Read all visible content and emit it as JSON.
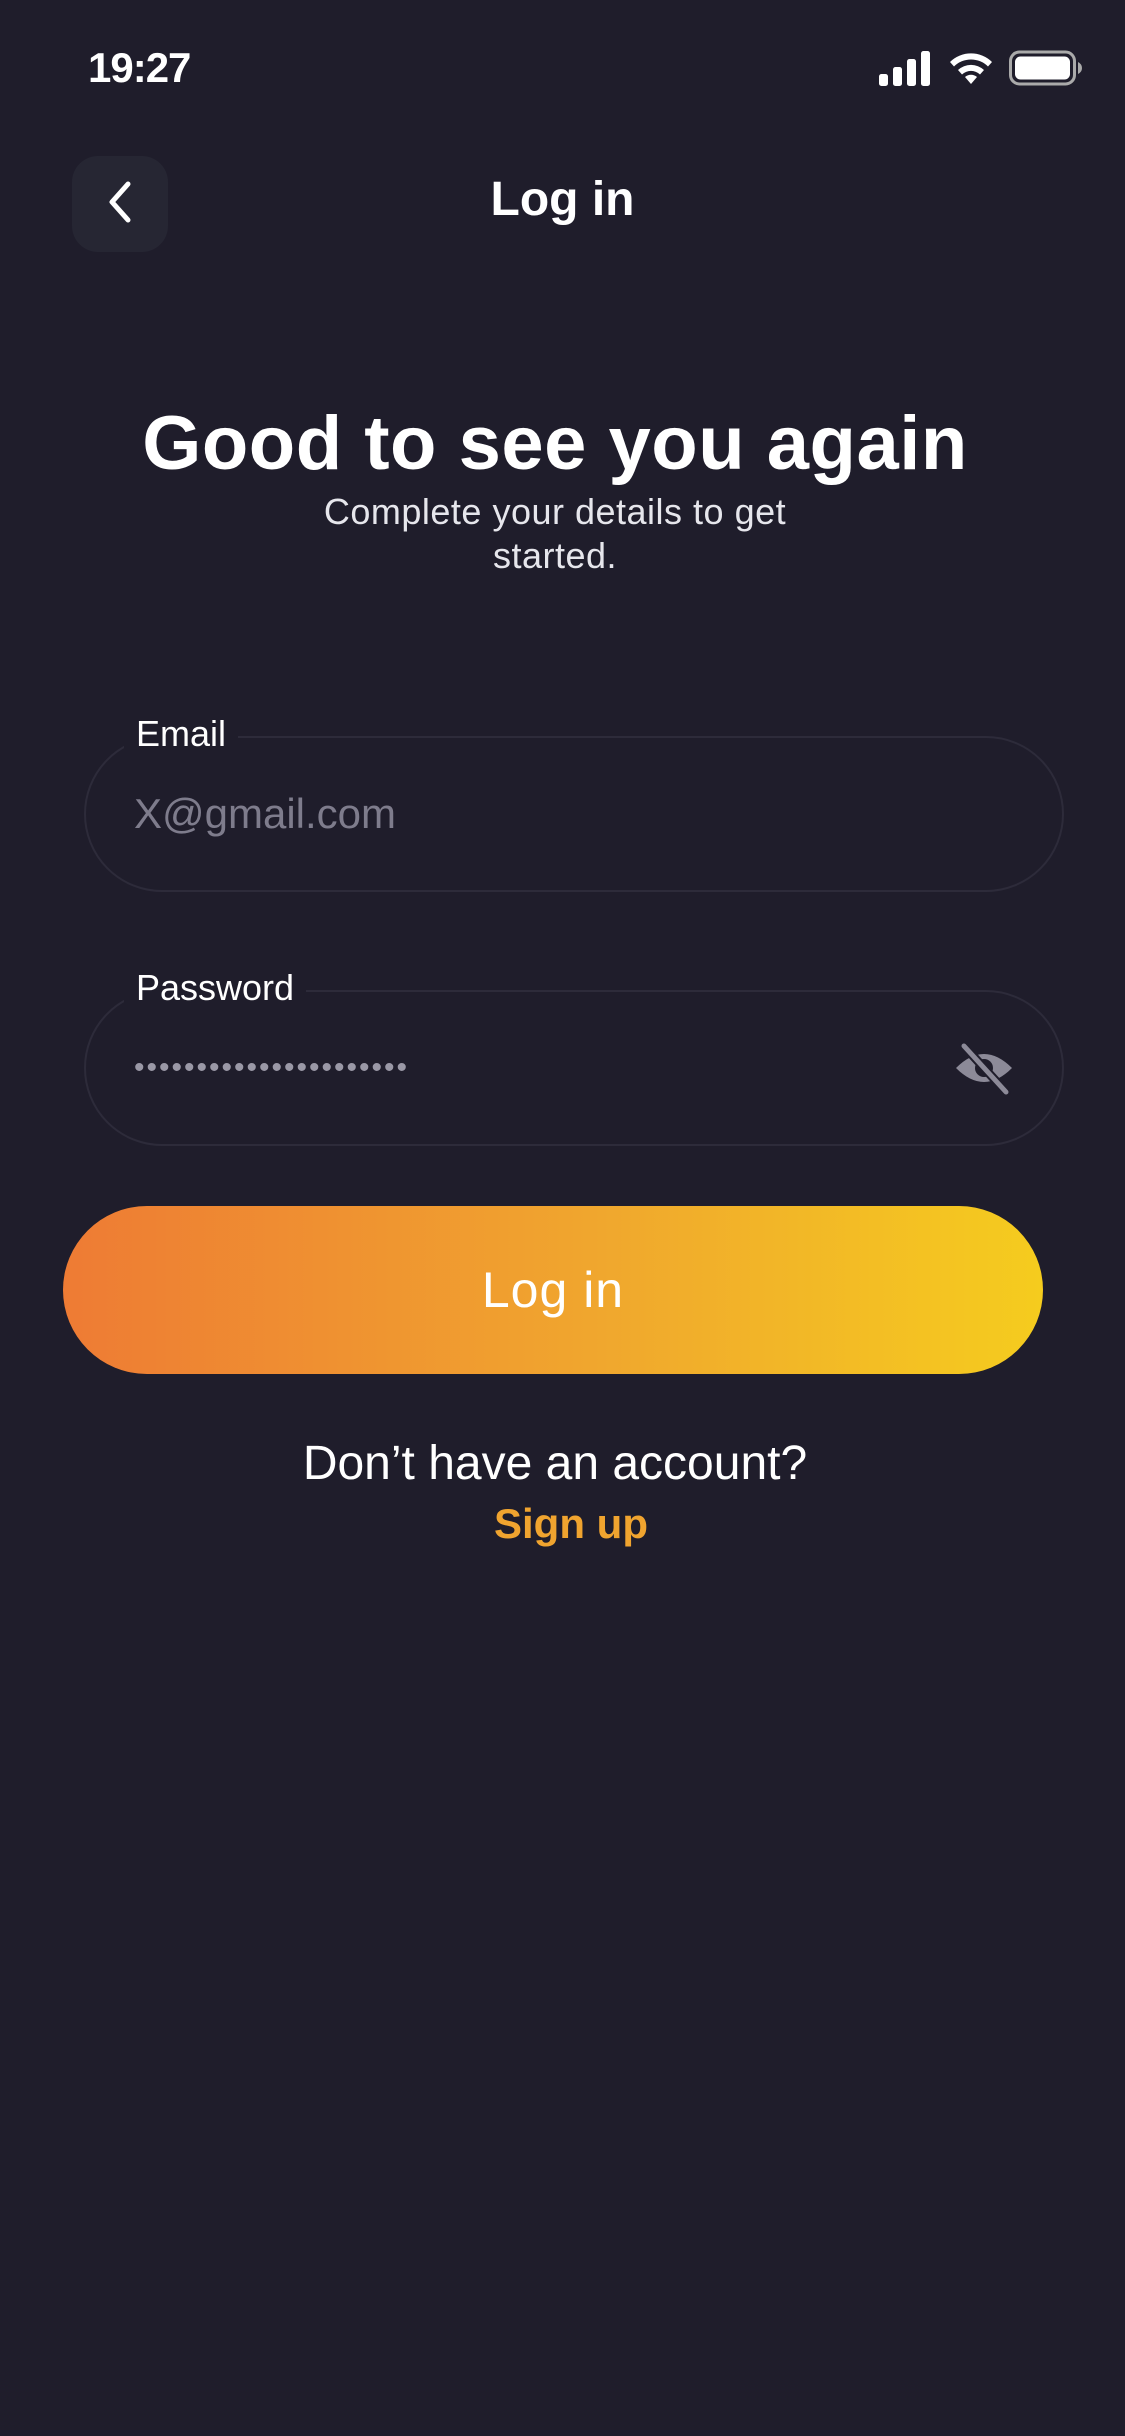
{
  "status_bar": {
    "time": "19:27",
    "icons": [
      "cellular-signal-icon",
      "wifi-icon",
      "battery-icon"
    ]
  },
  "nav": {
    "back_icon": "chevron-left-icon",
    "title": "Log in"
  },
  "header": {
    "headline": "Good to see you again",
    "subtitle": "Complete your details to get started."
  },
  "form": {
    "email": {
      "label": "Email",
      "placeholder": "X@gmail.com",
      "value": ""
    },
    "password": {
      "label": "Password",
      "value": "••••••••••••••••••••••",
      "toggle_icon": "eye-off-icon"
    },
    "submit_label": "Log in"
  },
  "footer": {
    "prompt": "Don’t have an account?",
    "signup_label": "Sign up"
  },
  "colors": {
    "background": "#1f1d2b",
    "accent": "#f0a42f",
    "gradient_start": "#ee7b34",
    "gradient_end": "#f5cc1e"
  }
}
